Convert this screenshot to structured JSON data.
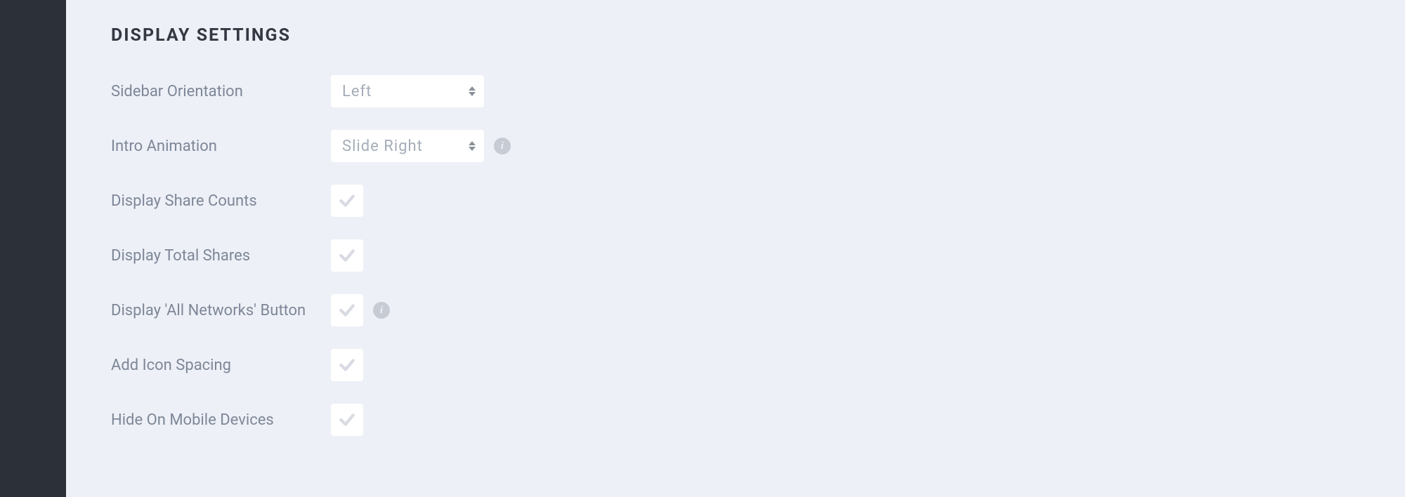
{
  "section_title": "DISPLAY SETTINGS",
  "rows": {
    "sidebar_orientation": {
      "label": "Sidebar Orientation",
      "value": "Left"
    },
    "intro_animation": {
      "label": "Intro Animation",
      "value": "Slide Right"
    },
    "display_share_counts": {
      "label": "Display Share Counts"
    },
    "display_total_shares": {
      "label": "Display Total Shares"
    },
    "display_all_networks": {
      "label": "Display 'All Networks' Button"
    },
    "add_icon_spacing": {
      "label": "Add Icon Spacing"
    },
    "hide_on_mobile": {
      "label": "Hide On Mobile Devices"
    }
  },
  "info_glyph": "i"
}
